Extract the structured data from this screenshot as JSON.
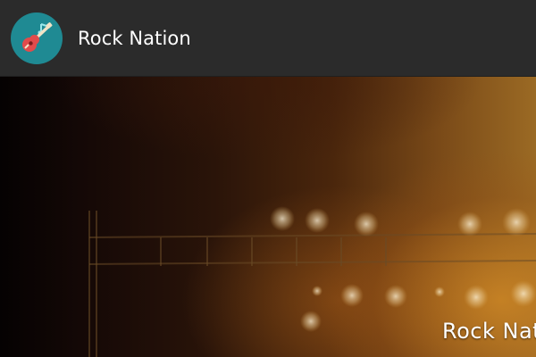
{
  "app": {
    "title": "Rock Nation",
    "icon": "guitar-icon",
    "accent_color": "#1f8a93"
  },
  "hero": {
    "caption": "Rock Nation"
  }
}
